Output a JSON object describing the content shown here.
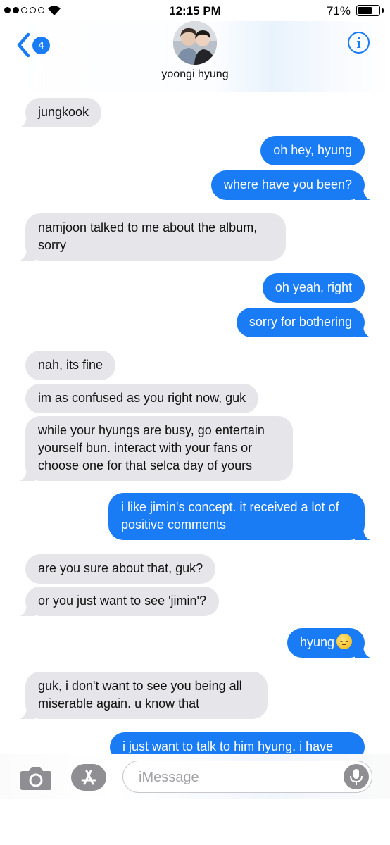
{
  "status_bar": {
    "time": "12:15 PM",
    "battery_percent": "71%",
    "battery_level": 0.71,
    "signal_bars_filled": 2,
    "signal_bars_total": 5
  },
  "header": {
    "back_badge": "4",
    "contact_name": "yoongi hyung",
    "info_label": "i"
  },
  "messages": [
    {
      "from": "in",
      "text": "jungkook"
    },
    {
      "from": "out",
      "text": "oh hey, hyung"
    },
    {
      "from": "out",
      "text": "where have you been?"
    },
    {
      "from": "in",
      "text": "namjoon talked to me about the album, sorry"
    },
    {
      "from": "out",
      "text": "oh yeah, right"
    },
    {
      "from": "out",
      "text": "sorry for bothering"
    },
    {
      "from": "in",
      "text": "nah, its fine"
    },
    {
      "from": "in",
      "text": "im as confused as you right now, guk"
    },
    {
      "from": "in",
      "text": "while your hyungs are busy, go entertain yourself bun. interact with your fans or choose one for that selca day of yours"
    },
    {
      "from": "out",
      "text": "i like jimin's concept. it received a lot of positive comments"
    },
    {
      "from": "in",
      "text": "are you sure about that, guk?"
    },
    {
      "from": "in",
      "text": "or you just want to see 'jimin'?"
    },
    {
      "from": "out",
      "text": "hyung",
      "emoji": "pensive-face"
    },
    {
      "from": "in",
      "text": "guk, i don't want to see you being all miserable again. u know that"
    },
    {
      "from": "out",
      "text": "i just want to talk to him hyung. i have"
    }
  ],
  "input_bar": {
    "placeholder": "iMessage",
    "value": ""
  },
  "colors": {
    "accent_blue": "#1a7cf5",
    "incoming_bubble": "#e5e5ea",
    "icon_gray": "#8e8e93"
  }
}
